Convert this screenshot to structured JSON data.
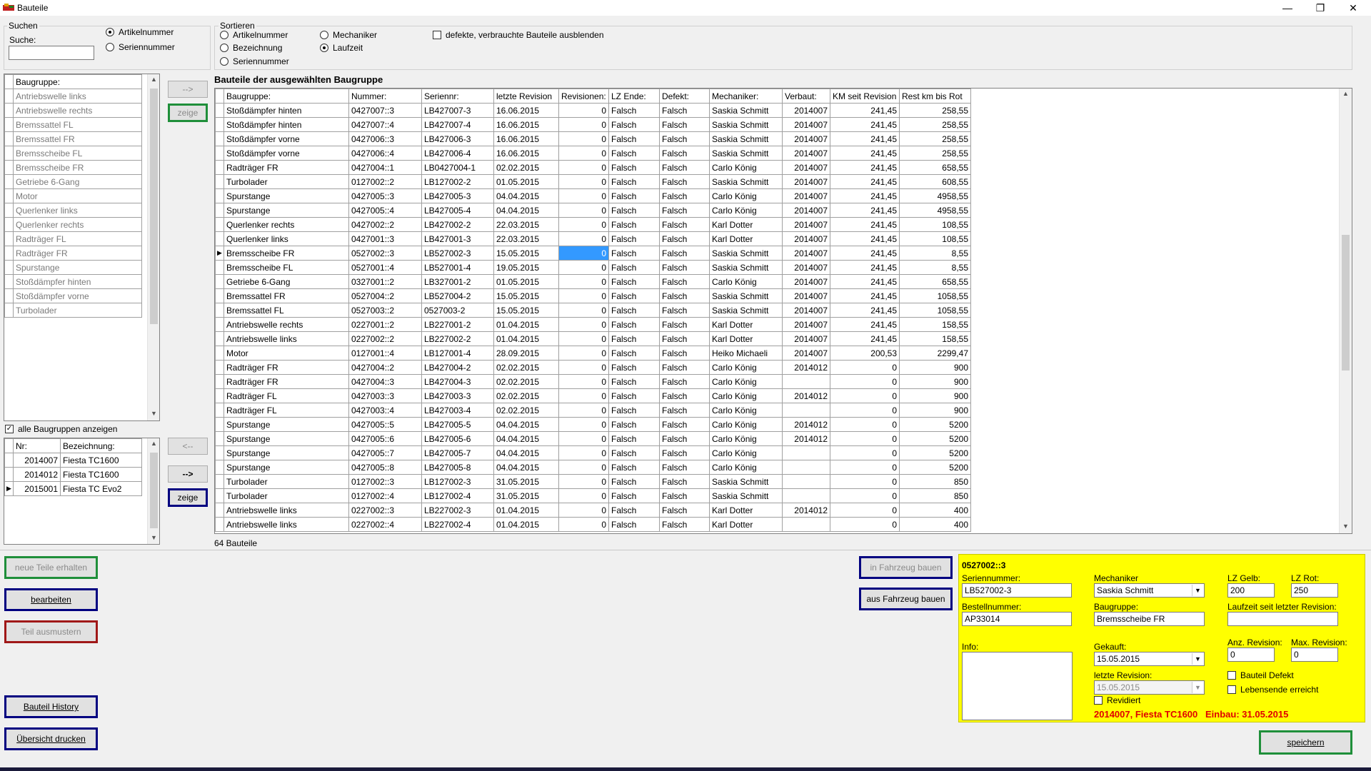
{
  "window": {
    "title": "Bauteile",
    "minimize": "—",
    "restore": "❐",
    "close": "✕"
  },
  "search": {
    "group_label": "Suchen",
    "label": "Suche:",
    "value": "",
    "radio_artikel": "Artikelnummer",
    "radio_serien": "Seriennummer"
  },
  "sort": {
    "group_label": "Sortieren",
    "opt_artikel": "Artikelnummer",
    "opt_bezeichnung": "Bezeichnung",
    "opt_serien": "Seriennummer",
    "opt_mechaniker": "Mechaniker",
    "opt_laufzeit": "Laufzeit",
    "hide_defect": "defekte, verbrauchte Bauteile ausblenden"
  },
  "baugruppen": {
    "header": "Baugruppe:",
    "items": [
      "Antriebswelle links",
      "Antriebswelle rechts",
      "Bremssattel FL",
      "Bremssattel FR",
      "Bremsscheibe FL",
      "Bremsscheibe FR",
      "Getriebe 6-Gang",
      "Motor",
      "Querlenker links",
      "Querlenker rechts",
      "Radträger FL",
      "Radträger FR",
      "Spurstange",
      "Stoßdämpfer hinten",
      "Stoßdämpfer vorne",
      "Turbolader"
    ],
    "show_all": "alle Baugruppen anzeigen"
  },
  "fahrzeuge": {
    "header_nr": "Nr:",
    "header_bez": "Bezeichnung:",
    "rows": [
      {
        "nr": "2014007",
        "bez": "Fiesta TC1600"
      },
      {
        "nr": "2014012",
        "bez": "Fiesta TC1600"
      },
      {
        "nr": "2015001",
        "bez": "Fiesta TC Evo2"
      }
    ]
  },
  "mid_buttons": {
    "arrow_right_top": "-->",
    "zeige_top": "zeige",
    "arrow_left": "<--",
    "arrow_right": "-->",
    "zeige": "zeige"
  },
  "parts": {
    "title": "Bauteile der ausgewählten Baugruppe",
    "count": "64 Bauteile",
    "columns": [
      "Baugruppe:",
      "Nummer:",
      "Seriennr:",
      "letzte Revision",
      "Revisionen:",
      "LZ Ende:",
      "Defekt:",
      "Mechaniker:",
      "Verbaut:",
      "KM seit Revision",
      "Rest km bis Rot"
    ],
    "rows": [
      [
        "Stoßdämpfer hinten",
        "0427007::3",
        "LB427007-3",
        "16.06.2015",
        "0",
        "Falsch",
        "Falsch",
        "Saskia Schmitt",
        "2014007",
        "241,45",
        "258,55"
      ],
      [
        "Stoßdämpfer hinten",
        "0427007::4",
        "LB427007-4",
        "16.06.2015",
        "0",
        "Falsch",
        "Falsch",
        "Saskia Schmitt",
        "2014007",
        "241,45",
        "258,55"
      ],
      [
        "Stoßdämpfer vorne",
        "0427006::3",
        "LB427006-3",
        "16.06.2015",
        "0",
        "Falsch",
        "Falsch",
        "Saskia Schmitt",
        "2014007",
        "241,45",
        "258,55"
      ],
      [
        "Stoßdämpfer vorne",
        "0427006::4",
        "LB427006-4",
        "16.06.2015",
        "0",
        "Falsch",
        "Falsch",
        "Saskia Schmitt",
        "2014007",
        "241,45",
        "258,55"
      ],
      [
        "Radträger FR",
        "0427004::1",
        "LB0427004-1",
        "02.02.2015",
        "0",
        "Falsch",
        "Falsch",
        "Carlo König",
        "2014007",
        "241,45",
        "658,55"
      ],
      [
        "Turbolader",
        "0127002::2",
        "LB127002-2",
        "01.05.2015",
        "0",
        "Falsch",
        "Falsch",
        "Saskia Schmitt",
        "2014007",
        "241,45",
        "608,55"
      ],
      [
        "Spurstange",
        "0427005::3",
        "LB427005-3",
        "04.04.2015",
        "0",
        "Falsch",
        "Falsch",
        "Carlo König",
        "2014007",
        "241,45",
        "4958,55"
      ],
      [
        "Spurstange",
        "0427005::4",
        "LB427005-4",
        "04.04.2015",
        "0",
        "Falsch",
        "Falsch",
        "Carlo König",
        "2014007",
        "241,45",
        "4958,55"
      ],
      [
        "Querlenker rechts",
        "0427002::2",
        "LB427002-2",
        "22.03.2015",
        "0",
        "Falsch",
        "Falsch",
        "Karl Dotter",
        "2014007",
        "241,45",
        "108,55"
      ],
      [
        "Querlenker links",
        "0427001::3",
        "LB427001-3",
        "22.03.2015",
        "0",
        "Falsch",
        "Falsch",
        "Karl Dotter",
        "2014007",
        "241,45",
        "108,55"
      ],
      [
        "Bremsscheibe FR",
        "0527002::3",
        "LB527002-3",
        "15.05.2015",
        "0",
        "Falsch",
        "Falsch",
        "Saskia Schmitt",
        "2014007",
        "241,45",
        "8,55"
      ],
      [
        "Bremsscheibe FL",
        "0527001::4",
        "LB527001-4",
        "19.05.2015",
        "0",
        "Falsch",
        "Falsch",
        "Saskia Schmitt",
        "2014007",
        "241,45",
        "8,55"
      ],
      [
        "Getriebe 6-Gang",
        "0327001::2",
        "LB327001-2",
        "01.05.2015",
        "0",
        "Falsch",
        "Falsch",
        "Carlo König",
        "2014007",
        "241,45",
        "658,55"
      ],
      [
        "Bremssattel FR",
        "0527004::2",
        "LB527004-2",
        "15.05.2015",
        "0",
        "Falsch",
        "Falsch",
        "Saskia Schmitt",
        "2014007",
        "241,45",
        "1058,55"
      ],
      [
        "Bremssattel FL",
        "0527003::2",
        "0527003-2",
        "15.05.2015",
        "0",
        "Falsch",
        "Falsch",
        "Saskia Schmitt",
        "2014007",
        "241,45",
        "1058,55"
      ],
      [
        "Antriebswelle rechts",
        "0227001::2",
        "LB227001-2",
        "01.04.2015",
        "0",
        "Falsch",
        "Falsch",
        "Karl Dotter",
        "2014007",
        "241,45",
        "158,55"
      ],
      [
        "Antriebswelle links",
        "0227002::2",
        "LB227002-2",
        "01.04.2015",
        "0",
        "Falsch",
        "Falsch",
        "Karl Dotter",
        "2014007",
        "241,45",
        "158,55"
      ],
      [
        "Motor",
        "0127001::4",
        "LB127001-4",
        "28.09.2015",
        "0",
        "Falsch",
        "Falsch",
        "Heiko Michaeli",
        "2014007",
        "200,53",
        "2299,47"
      ],
      [
        "Radträger FR",
        "0427004::2",
        "LB427004-2",
        "02.02.2015",
        "0",
        "Falsch",
        "Falsch",
        "Carlo König",
        "2014012",
        "0",
        "900"
      ],
      [
        "Radträger FR",
        "0427004::3",
        "LB427004-3",
        "02.02.2015",
        "0",
        "Falsch",
        "Falsch",
        "Carlo König",
        "",
        "0",
        "900"
      ],
      [
        "Radträger FL",
        "0427003::3",
        "LB427003-3",
        "02.02.2015",
        "0",
        "Falsch",
        "Falsch",
        "Carlo König",
        "2014012",
        "0",
        "900"
      ],
      [
        "Radträger FL",
        "0427003::4",
        "LB427003-4",
        "02.02.2015",
        "0",
        "Falsch",
        "Falsch",
        "Carlo König",
        "",
        "0",
        "900"
      ],
      [
        "Spurstange",
        "0427005::5",
        "LB427005-5",
        "04.04.2015",
        "0",
        "Falsch",
        "Falsch",
        "Carlo König",
        "2014012",
        "0",
        "5200"
      ],
      [
        "Spurstange",
        "0427005::6",
        "LB427005-6",
        "04.04.2015",
        "0",
        "Falsch",
        "Falsch",
        "Carlo König",
        "2014012",
        "0",
        "5200"
      ],
      [
        "Spurstange",
        "0427005::7",
        "LB427005-7",
        "04.04.2015",
        "0",
        "Falsch",
        "Falsch",
        "Carlo König",
        "",
        "0",
        "5200"
      ],
      [
        "Spurstange",
        "0427005::8",
        "LB427005-8",
        "04.04.2015",
        "0",
        "Falsch",
        "Falsch",
        "Carlo König",
        "",
        "0",
        "5200"
      ],
      [
        "Turbolader",
        "0127002::3",
        "LB127002-3",
        "31.05.2015",
        "0",
        "Falsch",
        "Falsch",
        "Saskia Schmitt",
        "",
        "0",
        "850"
      ],
      [
        "Turbolader",
        "0127002::4",
        "LB127002-4",
        "31.05.2015",
        "0",
        "Falsch",
        "Falsch",
        "Saskia Schmitt",
        "",
        "0",
        "850"
      ],
      [
        "Antriebswelle links",
        "0227002::3",
        "LB227002-3",
        "01.04.2015",
        "0",
        "Falsch",
        "Falsch",
        "Karl Dotter",
        "2014012",
        "0",
        "400"
      ],
      [
        "Antriebswelle links",
        "0227002::4",
        "LB227002-4",
        "01.04.2015",
        "0",
        "Falsch",
        "Falsch",
        "Karl Dotter",
        "",
        "0",
        "400"
      ]
    ]
  },
  "left_buttons": {
    "neue_teile": "neue Teile erhalten",
    "bearbeiten": "bearbeiten",
    "ausmustern": "Teil ausmustern",
    "history": "Bauteil History",
    "drucken": "Übersicht drucken"
  },
  "vehicle_buttons": {
    "einbauen": "in Fahrzeug bauen",
    "ausbauen": "aus Fahrzeug bauen"
  },
  "detail": {
    "part_id": "0527002::3",
    "serien_label": "Seriennummer:",
    "serien_value": "LB527002-3",
    "bestell_label": "Bestellnummer:",
    "bestell_value": "AP33014",
    "info_label": "Info:",
    "info_value": "",
    "mechaniker_label": "Mechaniker",
    "mechaniker_value": "Saskia Schmitt",
    "baugruppe_label": "Baugruppe:",
    "baugruppe_value": "Bremsscheibe FR",
    "gekauft_label": "Gekauft:",
    "gekauft_value": "15.05.2015",
    "letzte_rev_label": "letzte Revision:",
    "letzte_rev_value": "15.05.2015",
    "revidiert_label": "Revidiert",
    "lz_gelb_label": "LZ Gelb:",
    "lz_gelb_value": "200",
    "lz_rot_label": "LZ Rot:",
    "lz_rot_value": "250",
    "laufzeit_label": "Laufzeit seit letzter Revision:",
    "laufzeit_value": "",
    "anz_rev_label": "Anz. Revision:",
    "anz_rev_value": "0",
    "max_rev_label": "Max. Revision:",
    "max_rev_value": "0",
    "defekt_label": "Bauteil Defekt",
    "lebensende_label": "Lebensende erreicht",
    "einbau_vehicle": "2014007, Fiesta TC1600",
    "einbau_date": "Einbau: 31.05.2015",
    "save": "speichern"
  }
}
